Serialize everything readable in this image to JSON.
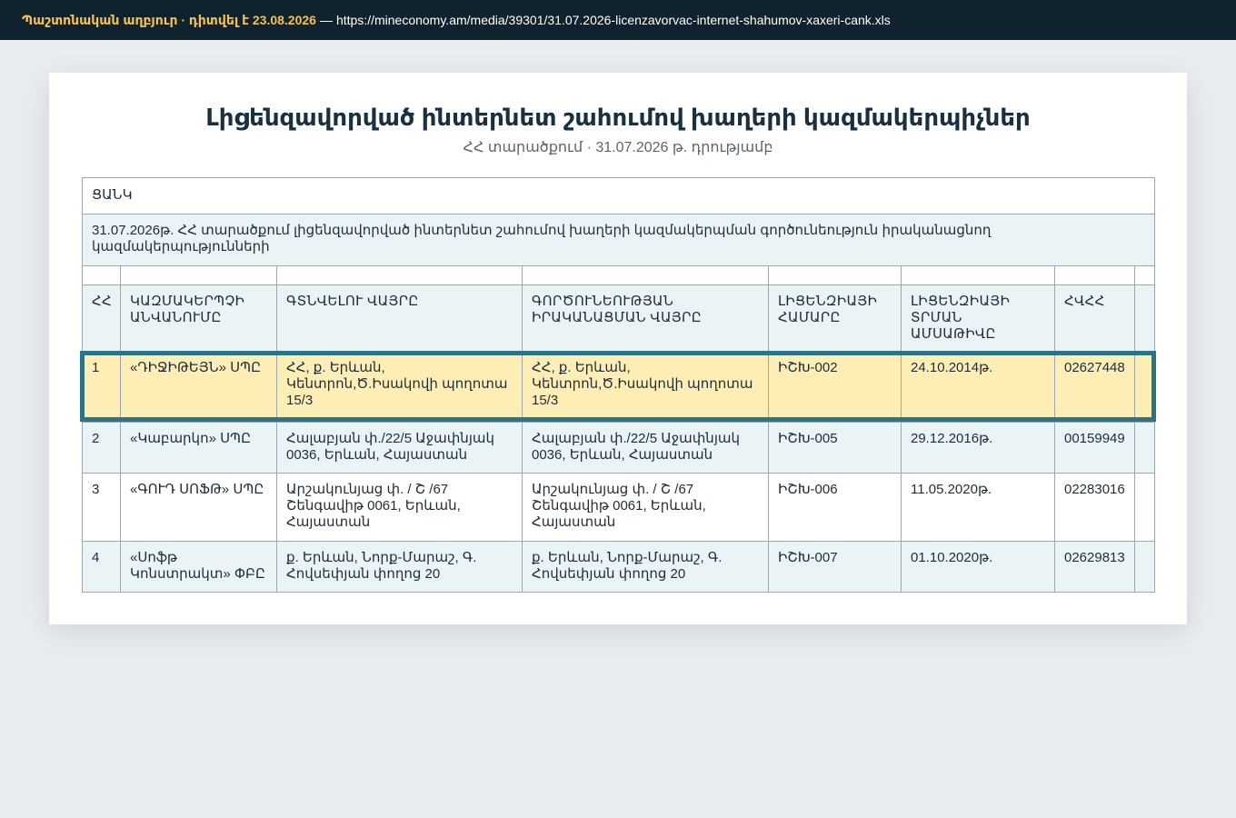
{
  "source_bar": {
    "label": "Պաշտոնական աղբյուր · դիտվել է 23.08.2026",
    "dash": "—",
    "url": "https://mineconomy.am/media/39301/31.07.2026-licenzavorvac-internet-shahumov-xaxeri-cank.xls"
  },
  "document": {
    "title": "Լիցենզավորված ինտերնետ շահումով խաղերի կազմակերպիչներ",
    "subtitle": "ՀՀ տարածքում · 31.07.2026 թ. դրությամբ",
    "caption": "ՑԱՆԿ",
    "description": "31.07.2026թ. ՀՀ տարածքում լիցենզավորված ինտերնետ շահումով խաղերի կազմակերպման գործունեություն իրականացնող կազմակերպությունների",
    "columns": [
      "ՀՀ",
      "Կազմակերպչի անվանումը",
      "Գտնվելու վայրը",
      "Գործունեության իրականացման վայրը",
      "Լիցենզիայի համարը",
      "Լիցենզիայի տրման ամսաթիվը",
      "ՀՎՀՀ",
      ""
    ],
    "rows": [
      {
        "no": "1",
        "name": "«ԴԻՋԻԹԵՅՆ» ՍՊԸ",
        "address": "ՀՀ, ք. Երևան, Կենտրոն,Ծ.Իսակովի պողոտա 15/3",
        "activity_place": "ՀՀ, ք. Երևան, Կենտրոն,Ծ.Իսակովի պողոտա 15/3",
        "license_no": "ԻՇԽ-002",
        "license_date": "24.10.2014թ.",
        "tin": "02627448",
        "extra": ""
      },
      {
        "no": "2",
        "name": "«Կաբարկո» ՍՊԸ",
        "address": "Հալաբյան փ./22/5 Աջափնյակ 0036, Երևան, Հայաստան",
        "activity_place": "Հալաբյան փ./22/5 Աջափնյակ 0036, Երևան, Հայաստան",
        "license_no": "ԻՇԽ-005",
        "license_date": "29.12.2016թ.",
        "tin": "00159949",
        "extra": ""
      },
      {
        "no": "3",
        "name": "«ԳՈՒԴ ՍՈՖԹ» ՍՊԸ",
        "address": "Արշակունյաց փ. / Շ /67 Շենգավիթ 0061, Երևան, Հայաստան",
        "activity_place": "Արշակունյաց փ. / Շ /67 Շենգավիթ 0061, Երևան, Հայաստան",
        "license_no": "ԻՇԽ-006",
        "license_date": "11.05.2020թ.",
        "tin": "02283016",
        "extra": ""
      },
      {
        "no": "4",
        "name": "«Սոֆթ Կոնստրակտ» ՓԲԸ",
        "address": "ք. Երևան, Նորք-Մարաշ, Գ. Հովսեփյան փողոց 20",
        "activity_place": "ք. Երևան, Նորք-Մարաշ, Գ. Հովսեփյան փողոց 20",
        "license_no": "ԻՇԽ-007",
        "license_date": "01.10.2020թ.",
        "tin": "02629813",
        "extra": ""
      }
    ]
  },
  "colors": {
    "topbar": "#11222f",
    "source_accent": "#f2c14e",
    "highlight_fill": "#fdeeb5",
    "highlight_border": "#2b7385"
  }
}
